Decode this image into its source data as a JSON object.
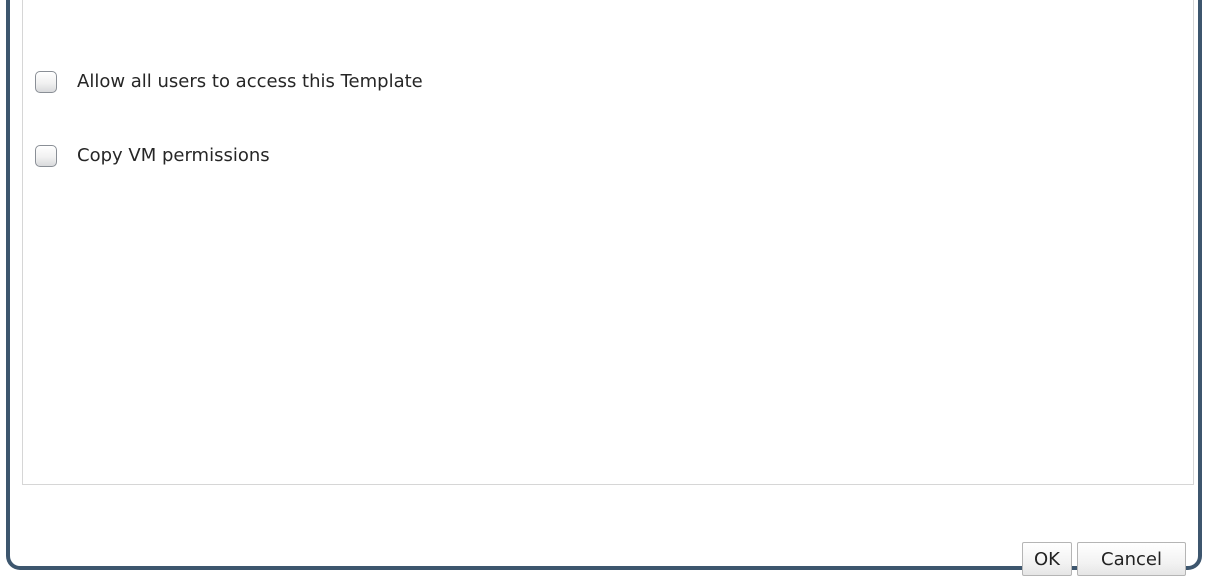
{
  "options": {
    "allow_all_users": {
      "label": "Allow all users to access this Template",
      "checked": false
    },
    "copy_vm_permissions": {
      "label": "Copy VM permissions",
      "checked": false
    }
  },
  "footer": {
    "ok_label": "OK",
    "cancel_label": "Cancel"
  },
  "colors": {
    "dialog_border": "#3d566e",
    "panel_border": "#d6d6d6"
  }
}
